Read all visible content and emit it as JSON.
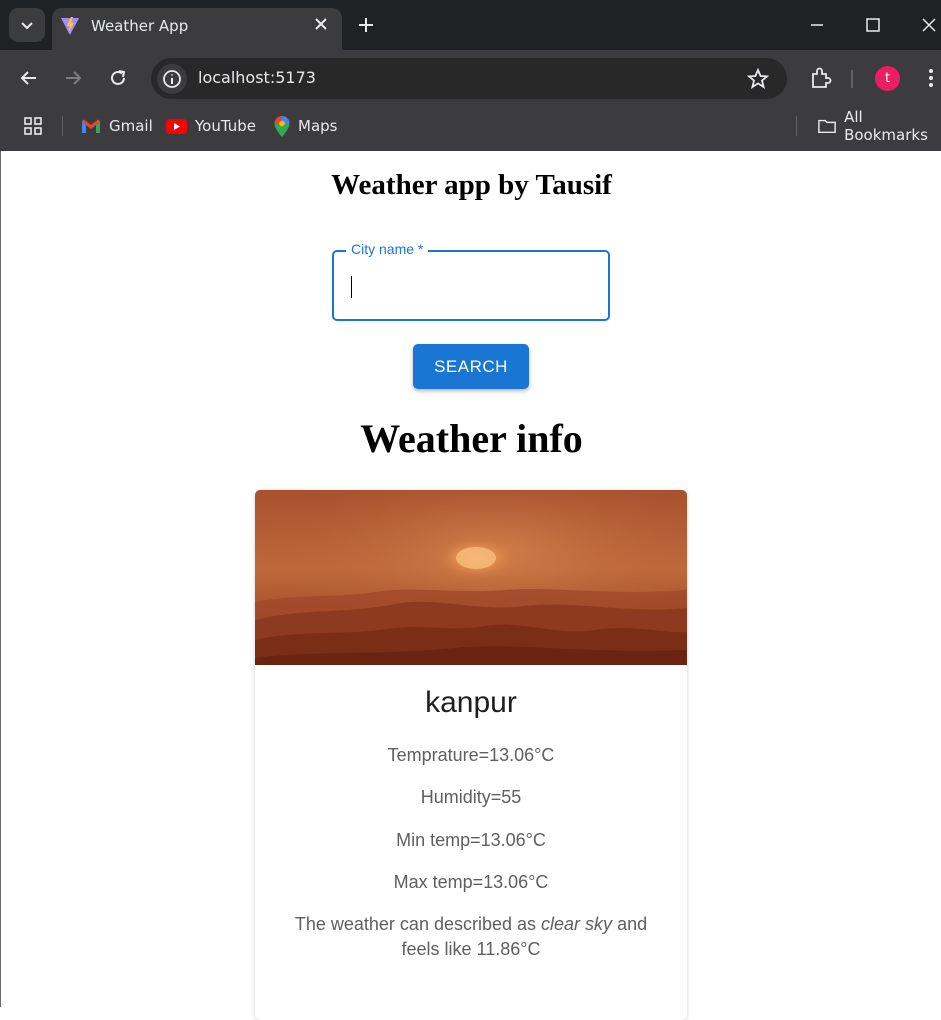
{
  "browser": {
    "tab_title": "Weather App",
    "url": "localhost:5173",
    "avatar_letter": "t",
    "bookmarks": [
      {
        "label": "Gmail"
      },
      {
        "label": "YouTube"
      },
      {
        "label": "Maps"
      }
    ],
    "all_bookmarks_label": "All Bookmarks"
  },
  "app": {
    "title": "Weather app by Tausif",
    "search_field": {
      "label": "City name *",
      "value": ""
    },
    "search_button_label": "SEARCH",
    "info_heading": "Weather info"
  },
  "weather": {
    "city": "kanpur",
    "temperature": "Temprature=13.06°C",
    "humidity": "Humidity=55",
    "min_temp": "Min temp=13.06°C",
    "max_temp": "Max temp=13.06°C",
    "desc_prefix": "The weather can described as",
    "desc_condition": "clear sky",
    "desc_suffix": "and feels like 11.86°C"
  },
  "colors": {
    "accent": "#1976d2",
    "chrome_bg": "#202124",
    "toolbar_bg": "#3c3c3f"
  }
}
